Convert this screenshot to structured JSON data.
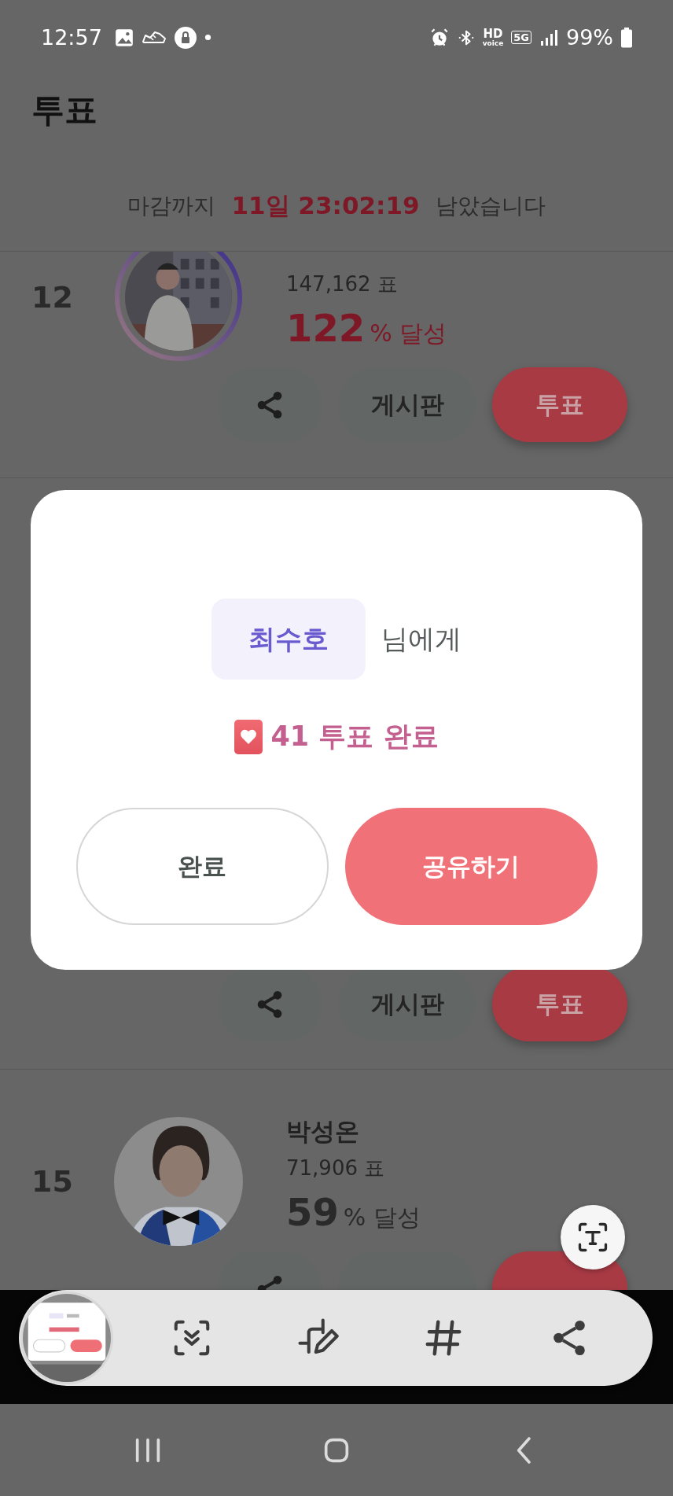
{
  "status_bar": {
    "time": "12:57",
    "hd_voice": [
      "HD",
      "voice"
    ],
    "network": "5G",
    "battery": "99%"
  },
  "header": {
    "title": "투표"
  },
  "deadline": {
    "prefix": "마감까지",
    "remaining": "11일 23:02:19",
    "suffix": "남았습니다"
  },
  "entries": [
    {
      "rank": "12",
      "votes": "147,162 표",
      "percent": "122",
      "percent_label": "% 달성",
      "achieved": true,
      "avatar": {
        "kind": "picture"
      },
      "actions": [
        {
          "kind": "share"
        },
        {
          "kind": "board",
          "label": "게시판"
        },
        {
          "kind": "vote",
          "label": "투표"
        }
      ]
    },
    {
      "actions": [
        {
          "kind": "share"
        },
        {
          "kind": "board",
          "label": "게시판"
        },
        {
          "kind": "vote",
          "label": "투표"
        }
      ]
    },
    {
      "rank": "15",
      "name": "박성온",
      "votes": "71,906 표",
      "percent": "59",
      "percent_label": "% 달성",
      "achieved": false,
      "avatar": {
        "kind": "picture"
      },
      "actions": [
        {
          "kind": "share"
        },
        {
          "kind": "board"
        },
        {
          "kind": "vote"
        }
      ]
    }
  ],
  "dialog": {
    "recipient": "최수호",
    "recipient_suffix": "님에게",
    "result": "41 투표 완료",
    "buttons": [
      {
        "kind": "secondary",
        "label": "완료"
      },
      {
        "kind": "primary",
        "label": "공유하기"
      }
    ]
  },
  "capture_toolbar": {
    "tools": [
      {
        "kind": "scroll_capture"
      },
      {
        "kind": "crop_edit"
      },
      {
        "kind": "tags"
      },
      {
        "kind": "share"
      }
    ]
  },
  "system_nav": [
    {
      "kind": "recents"
    },
    {
      "kind": "home"
    },
    {
      "kind": "back"
    }
  ]
}
